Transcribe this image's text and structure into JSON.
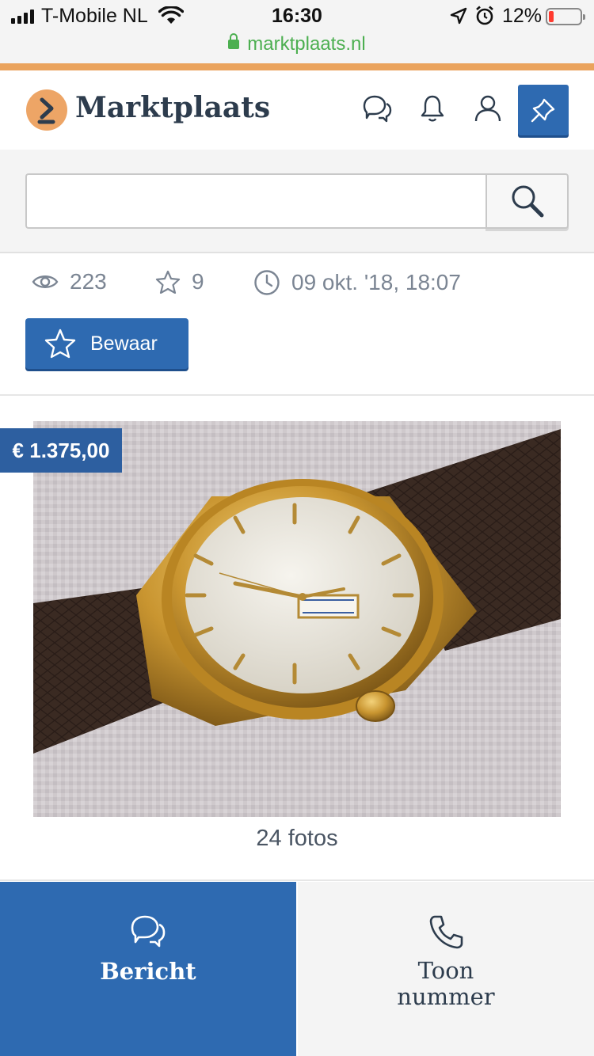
{
  "status_bar": {
    "carrier": "T-Mobile NL",
    "time": "16:30",
    "battery": "12%"
  },
  "browser": {
    "url": "marktplaats.nl"
  },
  "header": {
    "logo_text": "Marktplaats"
  },
  "search": {
    "value": "",
    "placeholder": ""
  },
  "listing": {
    "views": "223",
    "favorites": "9",
    "date": "09 okt. '18, 18:07",
    "save_label": "Bewaar",
    "price": "€ 1.375,00",
    "photo_count": "24 fotos"
  },
  "actions": {
    "message_label": "Bericht",
    "phone_label": "Toon nummer"
  },
  "colors": {
    "brand_blue": "#2e6ab1",
    "brand_orange": "#eda566",
    "text_dark": "#2d3c4d"
  }
}
